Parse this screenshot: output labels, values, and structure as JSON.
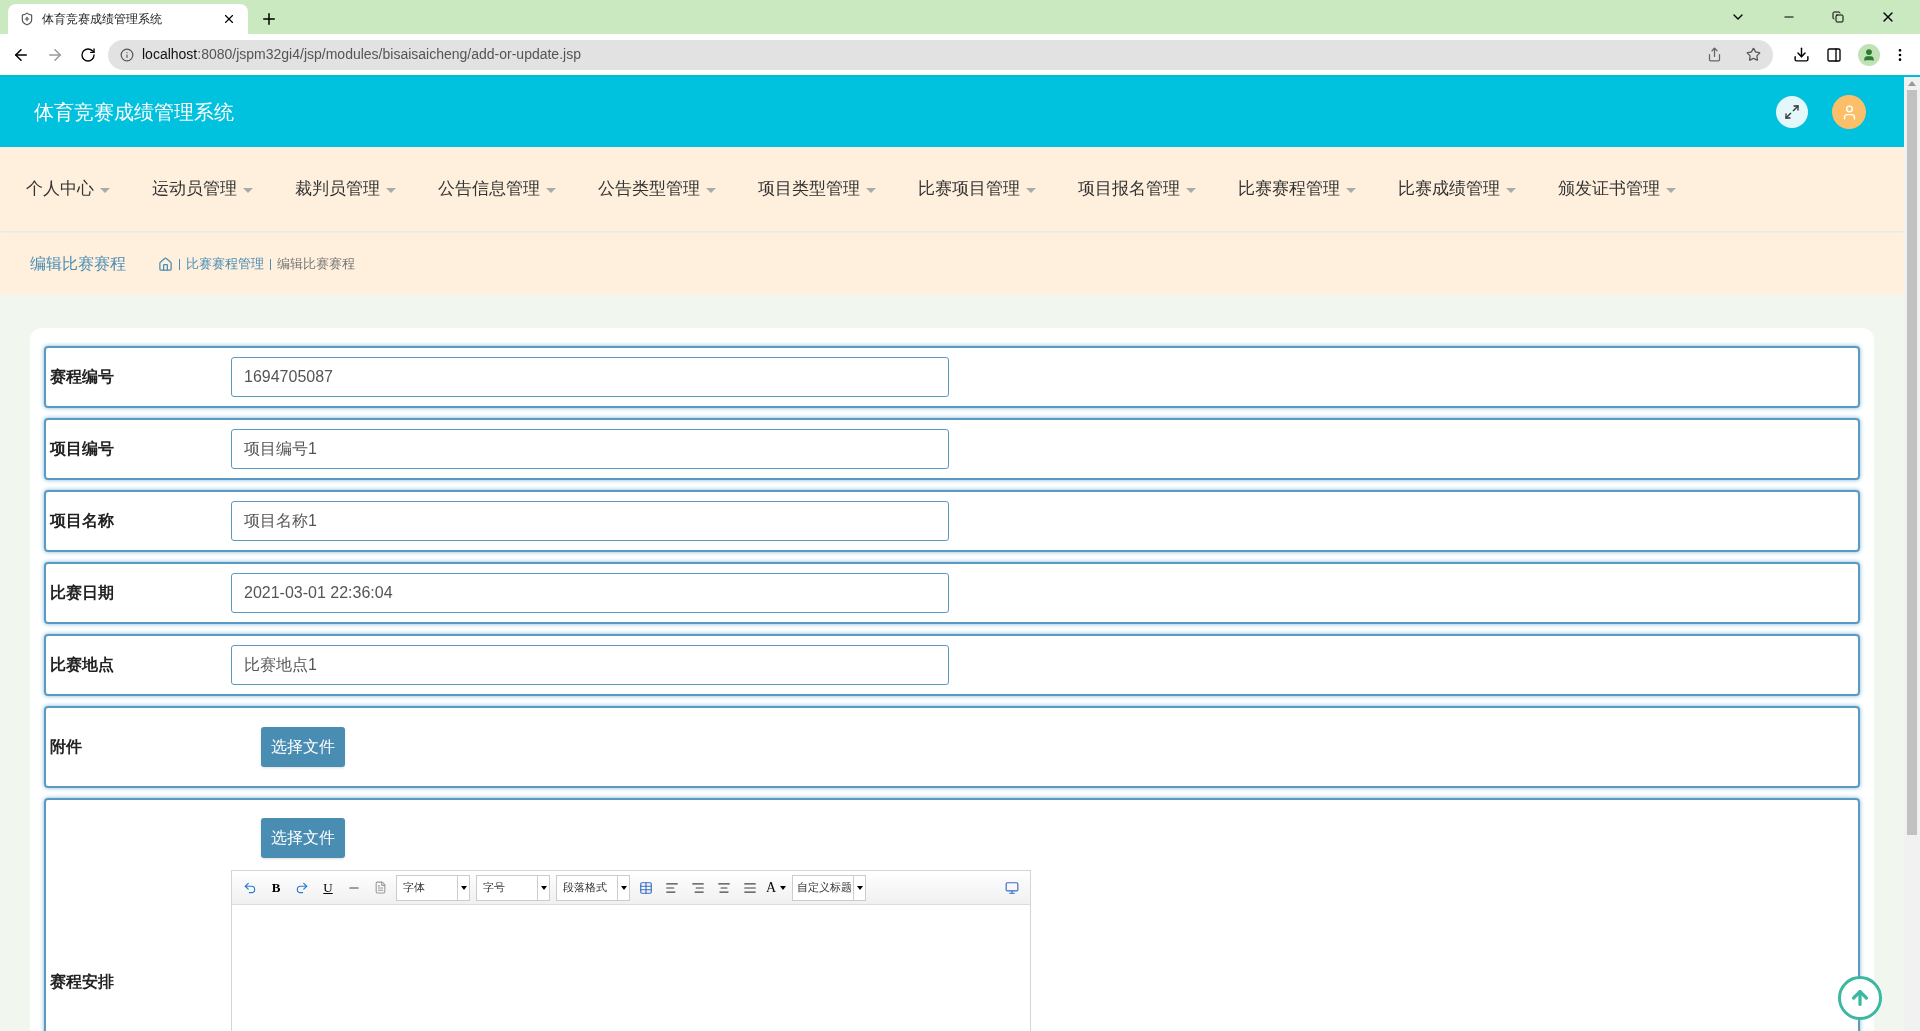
{
  "browser": {
    "tab_title": "体育竞赛成绩管理系统",
    "url_host": "localhost",
    "url_rest": ":8080/jspm32gi4/jsp/modules/bisaisaicheng/add-or-update.jsp"
  },
  "header": {
    "title": "体育竞赛成绩管理系统"
  },
  "nav": [
    "个人中心",
    "运动员管理",
    "裁判员管理",
    "公告信息管理",
    "公告类型管理",
    "项目类型管理",
    "比赛项目管理",
    "项目报名管理",
    "比赛赛程管理",
    "比赛成绩管理",
    "颁发证书管理"
  ],
  "breadcrumb": {
    "page_title": "编辑比赛赛程",
    "trail": [
      "比赛赛程管理",
      "编辑比赛赛程"
    ]
  },
  "form": [
    {
      "kind": "input",
      "label": "赛程编号",
      "value": "1694705087"
    },
    {
      "kind": "input",
      "label": "项目编号",
      "value": "项目编号1"
    },
    {
      "kind": "input",
      "label": "项目名称",
      "value": "项目名称1"
    },
    {
      "kind": "input",
      "label": "比赛日期",
      "value": "2021-03-01 22:36:04"
    },
    {
      "kind": "input",
      "label": "比赛地点",
      "value": "比赛地点1"
    },
    {
      "kind": "file",
      "label": "附件",
      "button": "选择文件"
    },
    {
      "kind": "editor",
      "label": "赛程安排",
      "button": "选择文件",
      "toolbar": {
        "bold": "B",
        "underline": "U",
        "font_color": "A",
        "selects": [
          "字体",
          "字号",
          "段落格式",
          "自定义标题"
        ]
      }
    }
  ]
}
